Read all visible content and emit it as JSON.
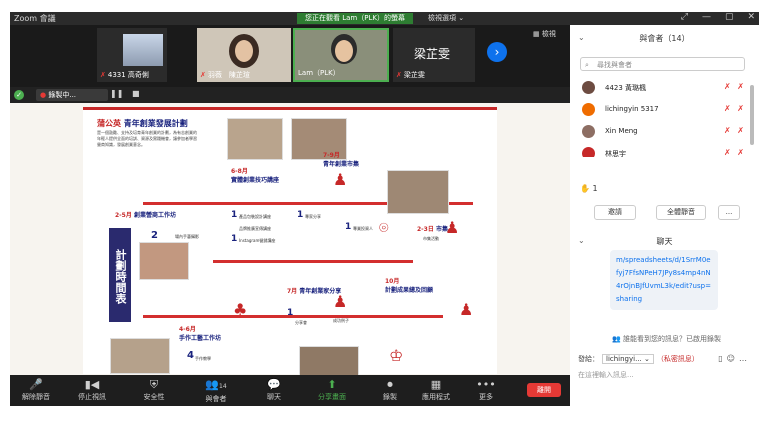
{
  "app_title": "Zoom 會議",
  "share_banner": "您正在觀看 Lam（PLK）的螢幕",
  "view_options": "檢視選項 ⌄",
  "video_strip": {
    "tiles": [
      {
        "name": "4331 高奇俐"
      },
      {
        "name": "羽薇　陳芷瑄"
      },
      {
        "name": "Lam（PLK）"
      }
    ],
    "big_name": "梁芷雯",
    "gallery_label": "檢視"
  },
  "share_controls": {
    "sharer_label": "錄製中..."
  },
  "poster": {
    "title_tag": "蒲公英",
    "title": "青年創業發展計劃",
    "intro": "是一個鼓勵、支持及培育青年創業的計劃，為有志創業的年輕人提供全面的培訓、資源及實踐機會，讓參加者學習營商知識，發展創業意念。",
    "side_title": "計劃時間表",
    "steps": [
      {
        "month": "2-5月",
        "title": "創業營商工作坊"
      },
      {
        "month": "6-8月",
        "title": "實體創業技巧講座"
      },
      {
        "month": "7-9月",
        "title": "青年創業市集"
      },
      {
        "month": "2-3日",
        "title": "市集"
      },
      {
        "month": "7月",
        "title": "青年創業家分享"
      },
      {
        "month": "10月",
        "title": "計劃成果總及回顧"
      },
      {
        "month": "4-6月",
        "title": "手作工藝工作坊"
      }
    ],
    "counts": [
      "2",
      "1",
      "1",
      "1",
      "1",
      "1",
      "4"
    ],
    "small_labels": [
      "場內手藝攝影",
      "產品包裝設計講座",
      "品牌推廣宣傳講座",
      "Instagram營銷講座",
      "專家分享",
      "專業投資人",
      "市集活動",
      "成功例子",
      "分享會",
      "手作教學"
    ]
  },
  "toolbar": {
    "buttons": [
      {
        "label": "解除靜音",
        "icon": "🎤"
      },
      {
        "label": "停止視訊",
        "icon": "📹"
      },
      {
        "label": "安全性",
        "icon": "🛡"
      },
      {
        "label": "與會者",
        "icon": "👥",
        "count": "14"
      },
      {
        "label": "聊天",
        "icon": "💬"
      },
      {
        "label": "分享畫面",
        "icon": "⬆"
      },
      {
        "label": "錄製",
        "icon": "⏺"
      },
      {
        "label": "應用程式",
        "icon": "▦"
      },
      {
        "label": "更多",
        "icon": "•••"
      }
    ],
    "leave": "離開"
  },
  "participants": {
    "header": "與會者（14）",
    "search_placeholder": "尋找與會者",
    "list": [
      {
        "name": "4423 黃璐楓",
        "color": "#6d4c41"
      },
      {
        "name": "lichingyin 5317",
        "color": "#ef6c00"
      },
      {
        "name": "Xin Meng",
        "color": "#8d6e63"
      },
      {
        "name": "林思宇",
        "color": "#c62828"
      }
    ],
    "raised_hands": "1",
    "invite": "邀請",
    "mute_all": "全體靜音",
    "more": "..."
  },
  "chat": {
    "header": "聊天",
    "message": "m/spreadsheets/d/1SrrM0efyj7FfsNPeH7JPy8s4mp4nN4rOjnBJfUvmL3k/edit?usp=sharing",
    "note": "誰能看到您的訊息？已啟用錄製",
    "send_to_label": "發給：",
    "recipient": "lichingyi...",
    "private": "（私密訊息）",
    "placeholder": "在這裡輸入訊息..."
  },
  "colors": {
    "accent": "#0e72ed",
    "share_green": "#2e7d32",
    "danger": "#e53935",
    "poster_red": "#c62828",
    "poster_navy": "#1a237e"
  }
}
